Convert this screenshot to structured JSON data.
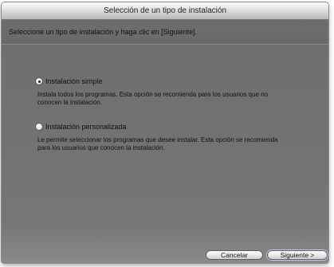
{
  "window": {
    "title": "Selección de un tipo de instalación"
  },
  "header": {
    "instruction": "Seleccione un tipo de instalación y haga clic en [Siguiente]."
  },
  "options": [
    {
      "label": "Instalación simple",
      "selected": true,
      "description_line1": "Instala todos los programas. Esta opción se recomienda para los usuarios que no",
      "description_line2": "conocen la instalación."
    },
    {
      "label": "Instalación personalizada",
      "selected": false,
      "description_line1": "Le permite seleccionar los programas que desee instalar. Esta opción se recomienda",
      "description_line2": "para los usuarios que conocen la instalación."
    }
  ],
  "buttons": {
    "cancel": "Cancelar",
    "next": "Siguiente >"
  }
}
